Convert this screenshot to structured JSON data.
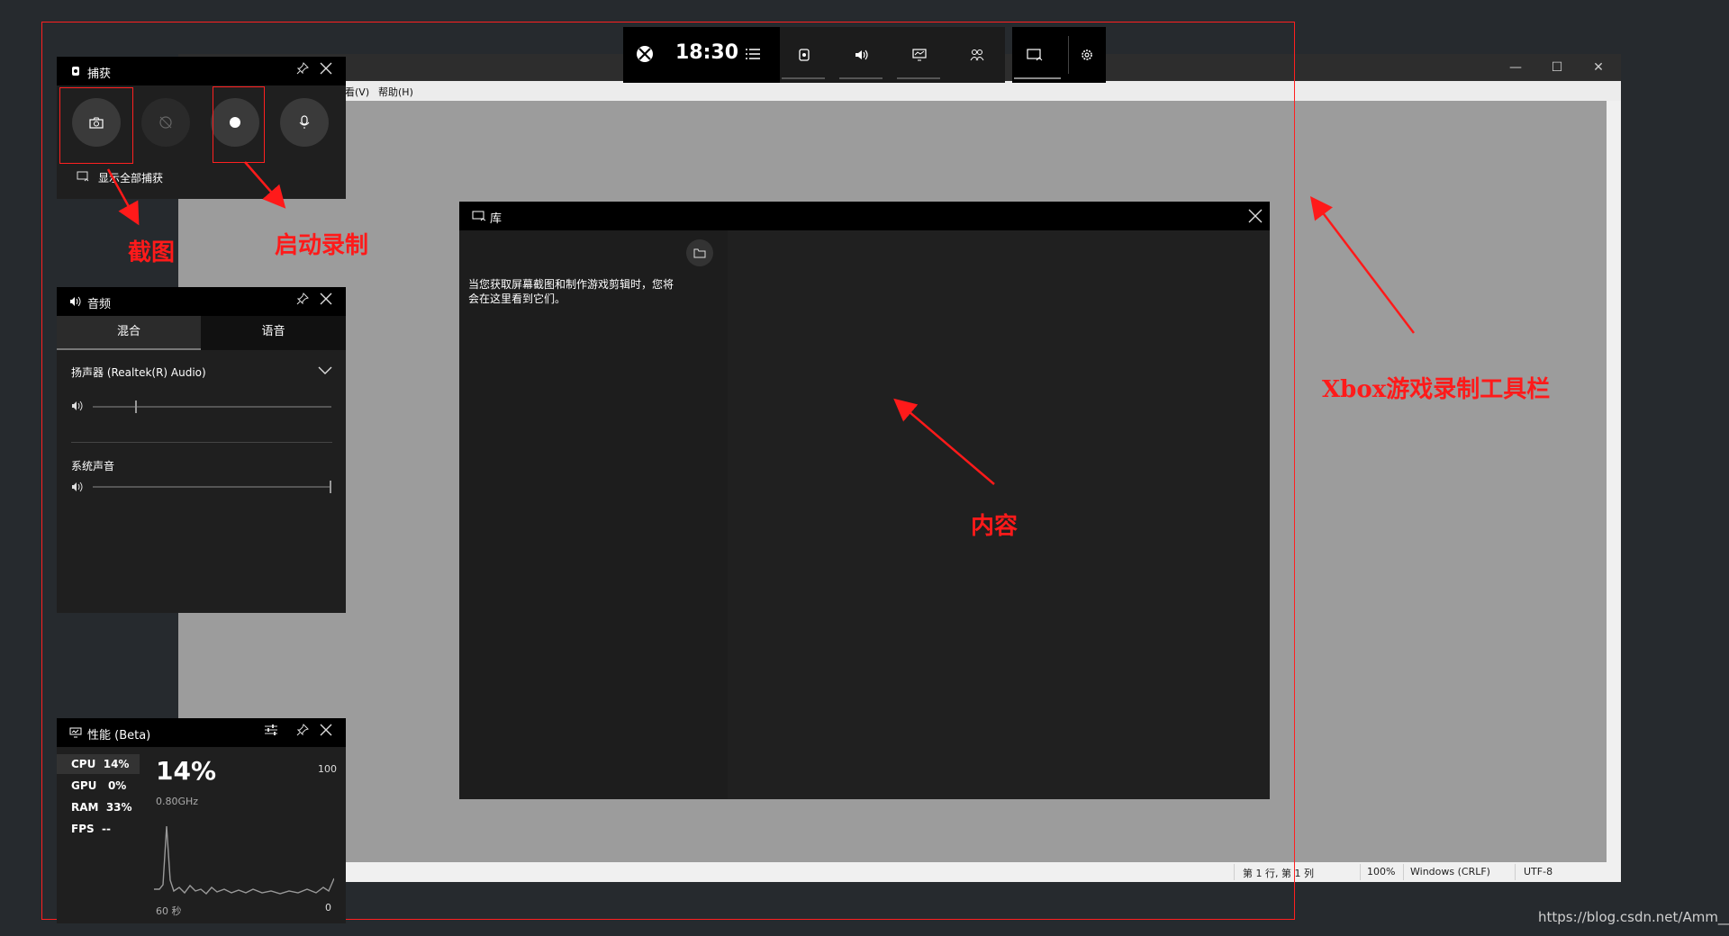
{
  "notepad": {
    "menu_view": "看(V)",
    "menu_help": "帮助(H)",
    "status_position": "第 1 行, 第 1 列",
    "status_zoom": "100%",
    "status_eol": "Windows (CRLF)",
    "status_encoding": "UTF-8"
  },
  "gamebar": {
    "time": "18:30"
  },
  "capture": {
    "title": "捕获",
    "show_all": "显示全部捕获"
  },
  "audio": {
    "title": "音频",
    "tab_mix": "混合",
    "tab_voice": "语音",
    "device": "扬声器 (Realtek(R) Audio)",
    "system_sound": "系统声音",
    "device_volume": 0.18,
    "system_volume": 1.0
  },
  "performance": {
    "title": "性能 (Beta)",
    "cpu_label": "CPU",
    "cpu_value": "14%",
    "gpu_label": "GPU",
    "gpu_value": "0%",
    "ram_label": "RAM",
    "ram_value": "33%",
    "fps_label": "FPS",
    "fps_value": "--",
    "big_value": "14%",
    "freq": "0.80GHz",
    "max": "100",
    "duration": "60 秒",
    "min": "0"
  },
  "gallery": {
    "title": "库",
    "empty_text_line1": "当您获取屏幕截图和制作游戏剪辑时，您将",
    "empty_text_line2": "会在这里看到它们。"
  },
  "annotations": {
    "screenshot": "截图",
    "start_record": "启动录制",
    "content": "内容",
    "toolbar": "Xbox游戏录制工具栏"
  },
  "watermark": "https://blog.csdn.net/Amm__",
  "colors": {
    "annotation_red": "#ff1a1a",
    "panel_dark": "#1f1f1f",
    "header_black": "#000000"
  }
}
